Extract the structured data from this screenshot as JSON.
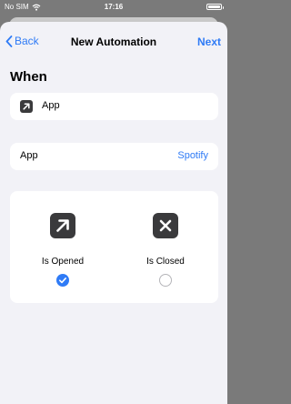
{
  "status_bar": {
    "carrier": "No SIM",
    "time": "17:16"
  },
  "nav": {
    "back_label": "Back",
    "title": "New Automation",
    "next_label": "Next"
  },
  "section_title": "When",
  "trigger": {
    "label": "App",
    "icon": "arrow-up-right-icon"
  },
  "app_setting": {
    "label": "App",
    "value": "Spotify"
  },
  "options": [
    {
      "label": "Is Opened",
      "icon": "arrow-up-right-icon",
      "selected": true
    },
    {
      "label": "Is Closed",
      "icon": "close-x-icon",
      "selected": false
    }
  ],
  "colors": {
    "accent": "#2f7bf6",
    "icon_bg": "#3a3a3c",
    "background": "#f2f2f7"
  }
}
